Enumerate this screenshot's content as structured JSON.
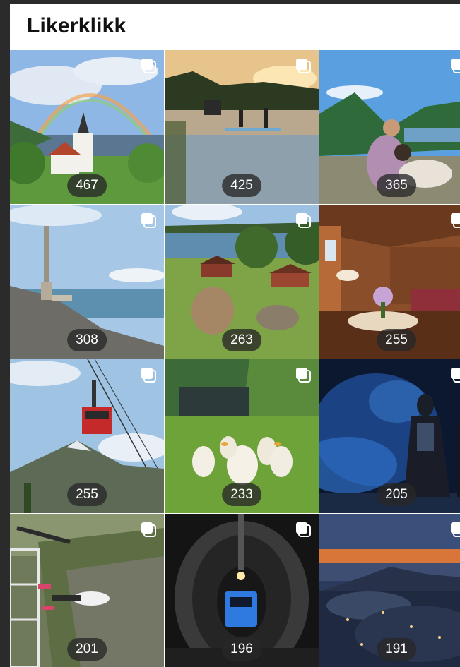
{
  "page": {
    "title": "Likerklikk"
  },
  "tiles": [
    {
      "count": "467",
      "subject": "church-rainbow"
    },
    {
      "count": "425",
      "subject": "paddleboard-lake"
    },
    {
      "count": "365",
      "subject": "woman-with-dog"
    },
    {
      "count": "308",
      "subject": "mountain-tower"
    },
    {
      "count": "263",
      "subject": "sheep-farm"
    },
    {
      "count": "255",
      "subject": "cabin-interior"
    },
    {
      "count": "255",
      "subject": "cable-car"
    },
    {
      "count": "233",
      "subject": "geese"
    },
    {
      "count": "205",
      "subject": "blue-smoke-figure"
    },
    {
      "count": "201",
      "subject": "bungee-jump"
    },
    {
      "count": "196",
      "subject": "mine-tunnel-train"
    },
    {
      "count": "191",
      "subject": "city-at-dusk"
    }
  ],
  "icons": {
    "multi_image": "stacked-squares-icon"
  }
}
